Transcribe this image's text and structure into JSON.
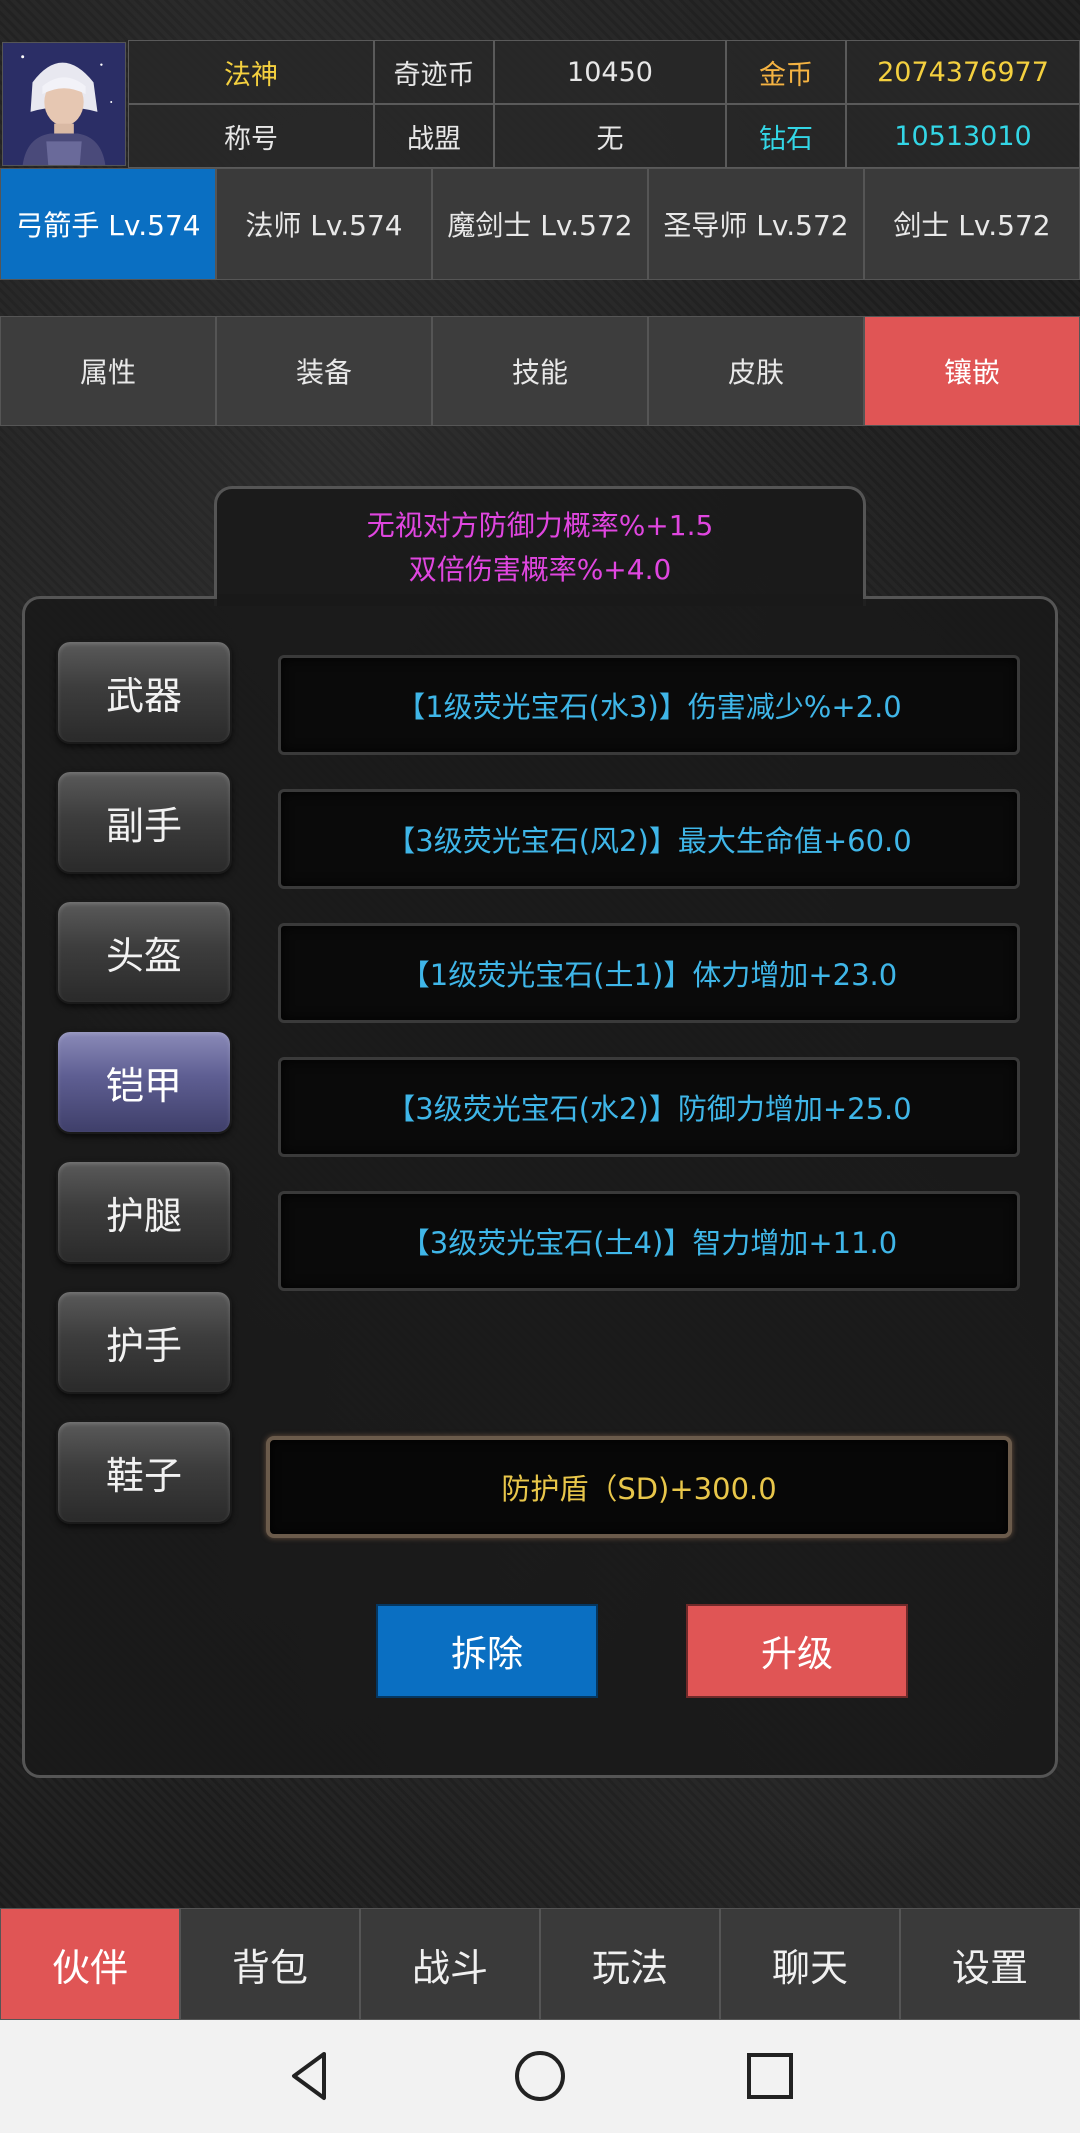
{
  "header": {
    "name": "法神",
    "title_label": "称号",
    "miracle_coin_label": "奇迹币",
    "miracle_coin_value": "10450",
    "alliance_label": "战盟",
    "alliance_value": "无",
    "gold_label": "金币",
    "gold_value": "2074376977",
    "diamond_label": "钻石",
    "diamond_value": "10513010"
  },
  "class_tabs": [
    {
      "label": "弓箭手 Lv.574",
      "active": true
    },
    {
      "label": "法师 Lv.574",
      "active": false
    },
    {
      "label": "魔剑士 Lv.572",
      "active": false
    },
    {
      "label": "圣导师 Lv.572",
      "active": false
    },
    {
      "label": "剑士 Lv.572",
      "active": false
    }
  ],
  "section_tabs": [
    {
      "label": "属性",
      "active": false
    },
    {
      "label": "装备",
      "active": false
    },
    {
      "label": "技能",
      "active": false
    },
    {
      "label": "皮肤",
      "active": false
    },
    {
      "label": "镶嵌",
      "active": true
    }
  ],
  "bonuses": [
    "无视对方防御力概率%+1.5",
    "双倍伤害概率%+4.0"
  ],
  "slots": [
    {
      "label": "武器",
      "active": false
    },
    {
      "label": "副手",
      "active": false
    },
    {
      "label": "头盔",
      "active": false
    },
    {
      "label": "铠甲",
      "active": true
    },
    {
      "label": "护腿",
      "active": false
    },
    {
      "label": "护手",
      "active": false
    },
    {
      "label": "鞋子",
      "active": false
    }
  ],
  "gems": [
    "【1级荧光宝石(水3)】伤害减少%+2.0",
    "【3级荧光宝石(风2)】最大生命值+60.0",
    "【1级荧光宝石(土1)】体力增加+23.0",
    "【3级荧光宝石(水2)】防御力增加+25.0",
    "【3级荧光宝石(土4)】智力增加+11.0"
  ],
  "shield": "防护盾（SD)+300.0",
  "actions": {
    "remove": "拆除",
    "upgrade": "升级"
  },
  "bottom_nav": [
    {
      "label": "伙伴",
      "active": true
    },
    {
      "label": "背包",
      "active": false
    },
    {
      "label": "战斗",
      "active": false
    },
    {
      "label": "玩法",
      "active": false
    },
    {
      "label": "聊天",
      "active": false
    },
    {
      "label": "设置",
      "active": false
    }
  ],
  "icons": {
    "back": "back-icon",
    "home": "home-icon",
    "recents": "recents-icon"
  },
  "colors": {
    "accent_blue": "#0a6fc2",
    "accent_red": "#e05555",
    "gem_text": "#3fb6e8",
    "bonus_text": "#e046e0",
    "gold_text": "#f4d03f"
  }
}
